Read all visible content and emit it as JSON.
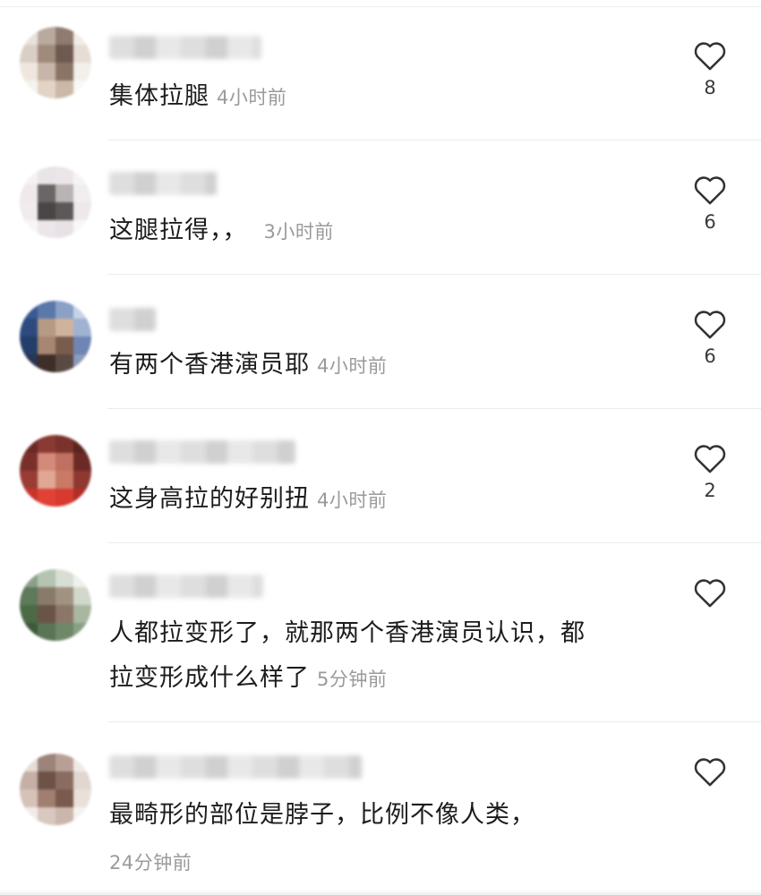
{
  "comments": [
    {
      "text": "集体拉腿",
      "time": "4小时前",
      "likes": "8"
    },
    {
      "text": "这腿拉得，，",
      "time": "3小时前",
      "likes": "6"
    },
    {
      "text": "有两个香港演员耶",
      "time": "4小时前",
      "likes": "6"
    },
    {
      "text": "这身高拉的好别扭",
      "time": "4小时前",
      "likes": "2"
    },
    {
      "text_line1": "人都拉变形了，就那两个香港演员认识，都",
      "text_line2": "拉变形成什么样了",
      "time": "5分钟前",
      "likes": ""
    },
    {
      "text": "最畸形的部位是脖子，比例不像人类，",
      "time": "24分钟前",
      "likes": ""
    }
  ],
  "icons": {
    "like": "heart-outline-icon"
  },
  "colors": {
    "text": "#1c1c1c",
    "time": "#9a9a9a",
    "divider": "#ebebeb",
    "icon": "#333333"
  }
}
